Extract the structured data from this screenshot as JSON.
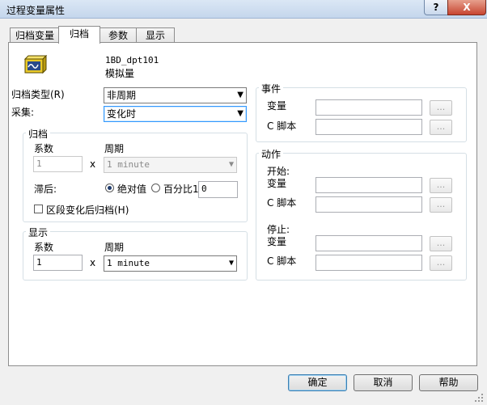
{
  "window": {
    "title": "过程变量属性",
    "help_button": "?",
    "close_button": "X"
  },
  "tabs": [
    {
      "label": "归档变量",
      "active": false
    },
    {
      "label": "归档",
      "active": true
    },
    {
      "label": "参数",
      "active": false
    },
    {
      "label": "显示",
      "active": false
    }
  ],
  "tag": {
    "name": "1BD_dpt101",
    "type": "模拟量",
    "icon": "analog-tag-icon"
  },
  "archive_type": {
    "label": "归档类型(R)",
    "value": "非周期"
  },
  "acquisition": {
    "label": "采集:",
    "value": "变化时"
  },
  "archive_group": {
    "legend": "归档",
    "factor_label": "系数",
    "cycle_label": "周期",
    "factor_value": "1",
    "times": "x",
    "cycle_value": "1 minute",
    "hysteresis_label": "滞后:",
    "absolute_label": "绝对值",
    "percent_label": "百分比1",
    "percent_value": "0",
    "segment_label": "区段变化后归档(H)"
  },
  "display_group": {
    "legend": "显示",
    "factor_label": "系数",
    "cycle_label": "周期",
    "factor_value": "1",
    "times": "x",
    "cycle_value": "1 minute"
  },
  "events_group": {
    "legend": "事件",
    "variable_label": "变量",
    "script_label": "C 脚本",
    "browse": "..."
  },
  "actions_group": {
    "legend": "动作",
    "start_label": "开始:",
    "stop_label": "停止:",
    "variable_label": "变量",
    "script_label": "C 脚本",
    "browse": "..."
  },
  "buttons": {
    "ok": "确定",
    "cancel": "取消",
    "help": "帮助"
  }
}
